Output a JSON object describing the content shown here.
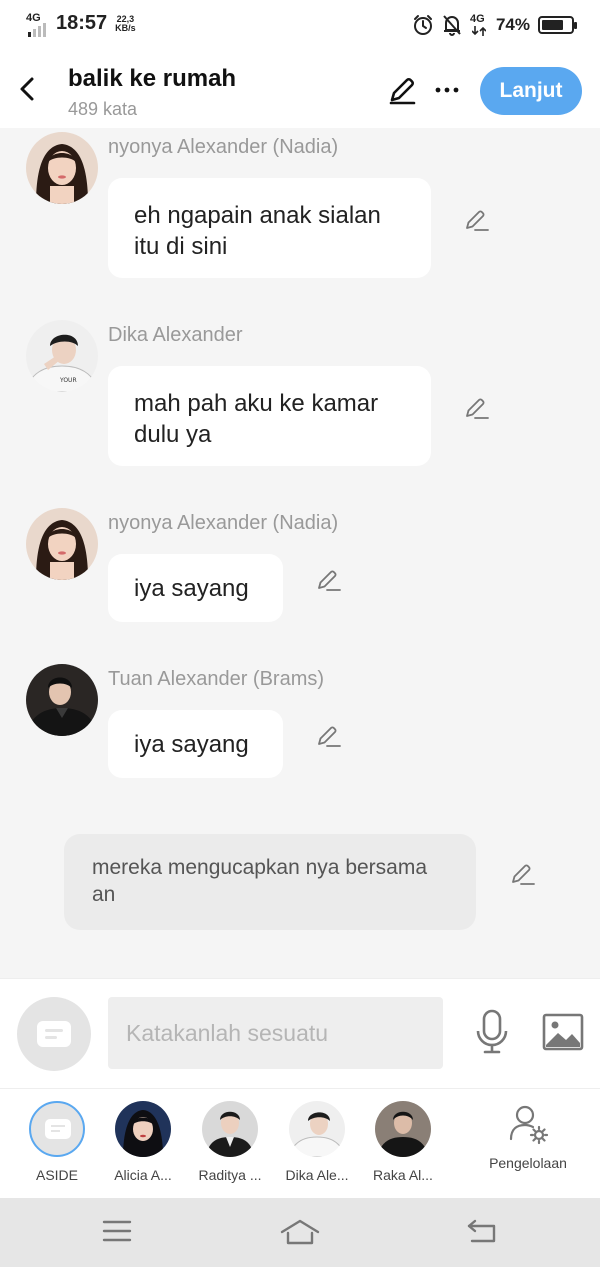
{
  "status_bar": {
    "network": "4G",
    "time": "18:57",
    "speed_value": "22,3",
    "speed_unit": "KB/s",
    "right_network": "4G",
    "battery_percent": "74%",
    "battery_level": 0.74,
    "icons": [
      "signal-bars-icon",
      "alarm-icon",
      "notifications-off-icon",
      "battery-icon"
    ]
  },
  "header": {
    "title": "balik ke rumah",
    "word_count": "489 kata",
    "next_button": "Lanjut",
    "accent_color": "#5aa8f0",
    "icons": [
      "back-arrow-icon",
      "pen-icon",
      "more-icon"
    ]
  },
  "messages": [
    {
      "sender": "nyonya Alexander (Nadia)",
      "text": "eh ngapain anak sialan itu di sini",
      "avatar": "avatar-nadia"
    },
    {
      "sender": "Dika Alexander",
      "text": "mah pah aku ke kamar dulu ya",
      "avatar": "avatar-dika"
    },
    {
      "sender": "nyonya Alexander (Nadia)",
      "text": "iya sayang",
      "avatar": "avatar-nadia"
    },
    {
      "sender": "Tuan Alexander (Brams)",
      "text": "iya sayang",
      "avatar": "avatar-brams"
    }
  ],
  "narration": {
    "text": "mereka mengucapkan nya bersama an"
  },
  "input": {
    "placeholder": "Katakanlah sesuatu",
    "value": "",
    "icons": [
      "aside-icon",
      "microphone-icon",
      "image-icon"
    ]
  },
  "characters": [
    {
      "label": "ASIDE",
      "selected": true
    },
    {
      "label": "Alicia A..."
    },
    {
      "label": "Raditya ..."
    },
    {
      "label": "Dika Ale..."
    },
    {
      "label": "Raka Al..."
    }
  ],
  "manage": {
    "label": "Pengelolaan",
    "icon": "user-settings-icon"
  },
  "nav": {
    "icons": [
      "menu-icon",
      "home-icon",
      "back-icon"
    ]
  }
}
